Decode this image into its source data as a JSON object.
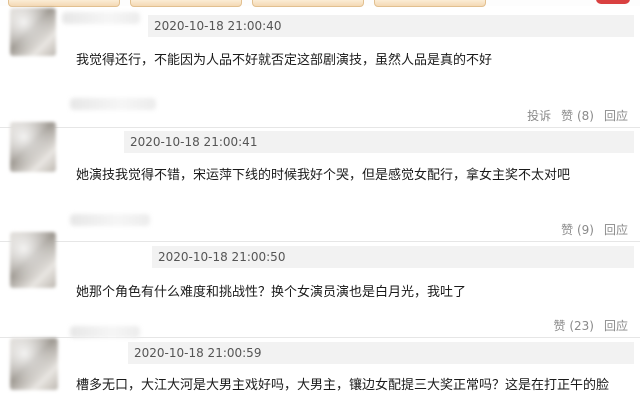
{
  "comments": [
    {
      "time": "2020-10-18 21:00:40",
      "text": "我觉得还行，不能因为人品不好就否定这部剧演技，虽然人品是真的不好",
      "actions": {
        "report": "投诉",
        "like": "赞 (8)",
        "reply": "回应"
      }
    },
    {
      "time": "2020-10-18 21:00:41",
      "text": "她演技我觉得不错，宋运萍下线的时候我好个哭，但是感觉女配行，拿女主奖不太对吧",
      "actions": {
        "like": "赞 (9)",
        "reply": "回应"
      }
    },
    {
      "time": "2020-10-18 21:00:50",
      "text": "她那个角色有什么难度和挑战性？换个女演员演也是白月光，我吐了",
      "actions": {
        "like": "赞 (23)",
        "reply": "回应"
      }
    },
    {
      "time": "2020-10-18 21:00:59",
      "text": "槽多无口，大江大河是大男主戏好吗，大男主，镶边女配提三大奖正常吗？这是在打正午的脸"
    }
  ]
}
